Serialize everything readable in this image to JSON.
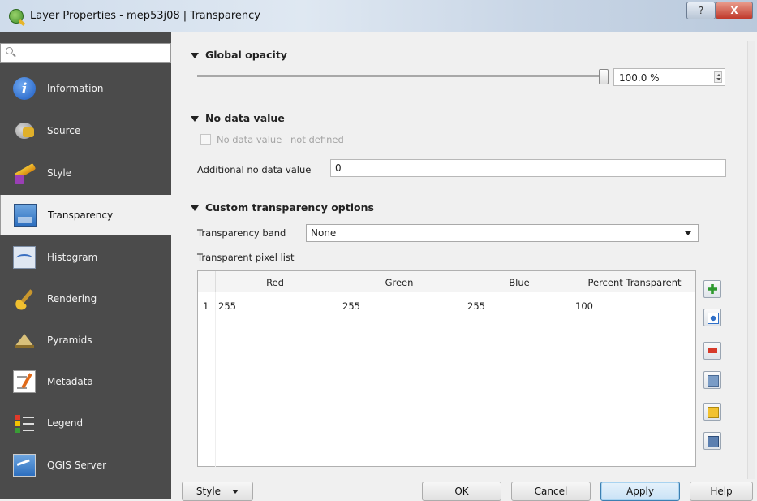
{
  "window": {
    "title": "Layer Properties - mep53j08 | Transparency",
    "help_label": "?",
    "close_label": "X"
  },
  "sidebar": {
    "search_placeholder": "",
    "items": [
      {
        "label": "Information",
        "icon": "info-icon"
      },
      {
        "label": "Source",
        "icon": "source-icon"
      },
      {
        "label": "Style",
        "icon": "style-icon"
      },
      {
        "label": "Transparency",
        "icon": "transparency-icon",
        "active": true
      },
      {
        "label": "Histogram",
        "icon": "histogram-icon"
      },
      {
        "label": "Rendering",
        "icon": "rendering-icon"
      },
      {
        "label": "Pyramids",
        "icon": "pyramids-icon"
      },
      {
        "label": "Metadata",
        "icon": "metadata-icon"
      },
      {
        "label": "Legend",
        "icon": "legend-icon"
      },
      {
        "label": "QGIS Server",
        "icon": "qgis-server-icon"
      }
    ]
  },
  "global_opacity": {
    "heading": "Global opacity",
    "value_text": "100.0 %",
    "level_fraction": 1.0
  },
  "no_data": {
    "heading": "No data value",
    "checkbox_label": "No data value",
    "checkbox_value": "not defined",
    "additional_label": "Additional no data value",
    "additional_value": "0"
  },
  "custom": {
    "heading": "Custom transparency options",
    "band_label": "Transparency band",
    "band_value": "None",
    "pixel_list_label": "Transparent pixel list",
    "columns": [
      "Red",
      "Green",
      "Blue",
      "Percent Transparent"
    ],
    "rows": [
      {
        "index": "1",
        "red": "255",
        "green": "255",
        "blue": "255",
        "percent": "100"
      }
    ]
  },
  "footer": {
    "style_label": "Style",
    "ok_label": "OK",
    "cancel_label": "Cancel",
    "apply_label": "Apply",
    "help_label": "Help"
  }
}
